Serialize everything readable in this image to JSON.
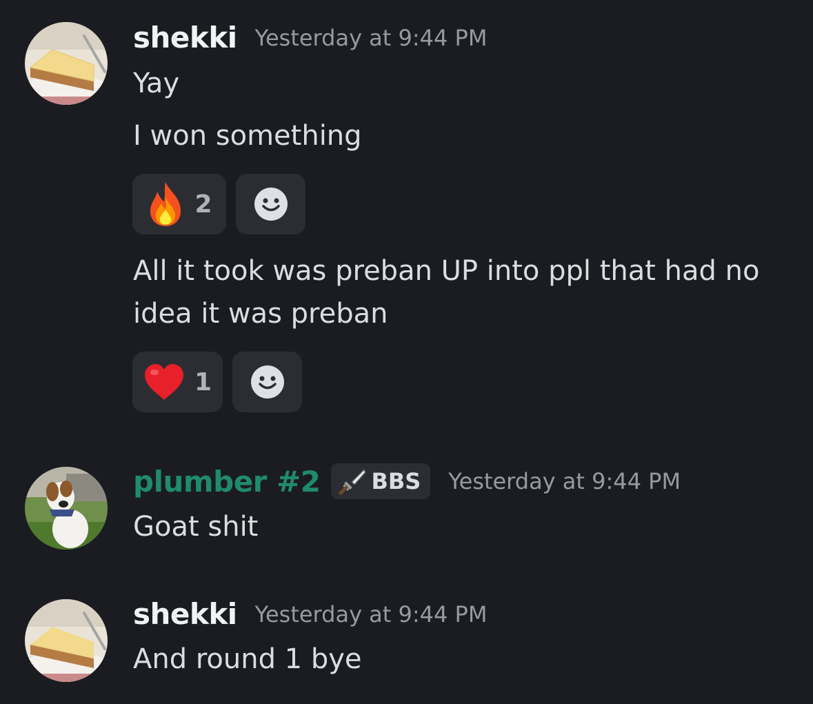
{
  "messages": [
    {
      "username": "shekki",
      "timestamp": "Yesterday at 9:44 PM",
      "avatar_icon": "cheesecake-avatar",
      "lines": [
        "Yay",
        "I won something",
        "All it took was preban UP into ppl that had no",
        "idea it was preban"
      ],
      "reactions_1": {
        "emoji_icon": "fire-emoji",
        "count": "2",
        "add_icon": "add-reaction-smiley-icon"
      },
      "reactions_2": {
        "emoji_icon": "red-heart-emoji",
        "count": "1",
        "add_icon": "add-reaction-smiley-icon"
      }
    },
    {
      "username": "plumber #2",
      "username_color": "#1f8b6c",
      "role_tag": {
        "icon": "sword-icon",
        "label": "BBS"
      },
      "timestamp": "Yesterday at 9:44 PM",
      "avatar_icon": "dog-avatar",
      "lines": [
        "Goat shit"
      ]
    },
    {
      "username": "shekki",
      "timestamp": "Yesterday at 9:44 PM",
      "avatar_icon": "cheesecake-avatar",
      "lines": [
        "And round 1 bye"
      ]
    }
  ],
  "colors": {
    "background": "#1b1c21",
    "reaction_bg": "#2b2d33",
    "timestamp": "#949ba4",
    "message_text": "#dbdee1",
    "role_username": "#1f8b6c"
  }
}
